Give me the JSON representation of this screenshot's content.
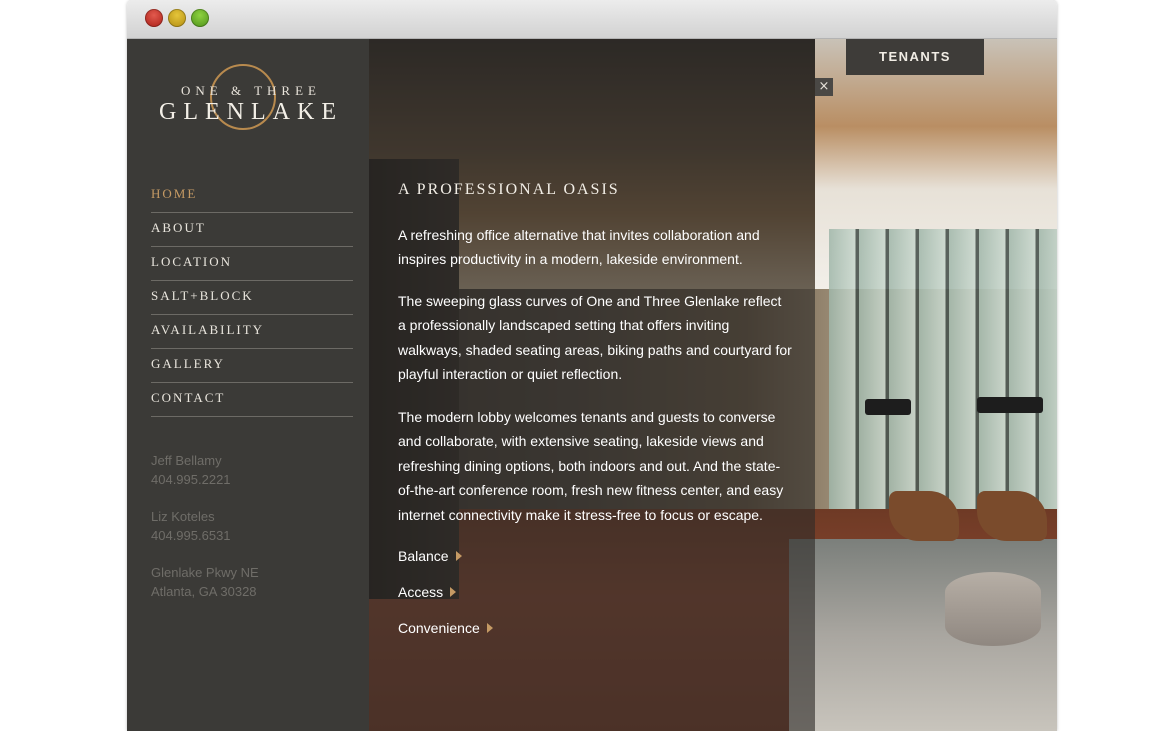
{
  "window": {
    "buttons": [
      "close",
      "minimize",
      "zoom"
    ]
  },
  "logo": {
    "top_line": "ONE & THREE",
    "main": "GLENLAKE",
    "accent_color": "#b88a4e"
  },
  "nav": {
    "items": [
      {
        "label": "HOME",
        "active": true
      },
      {
        "label": "ABOUT",
        "active": false
      },
      {
        "label": "LOCATION",
        "active": false
      },
      {
        "label": "SALT+BLOCK",
        "active": false
      },
      {
        "label": "AVAILABILITY",
        "active": false
      },
      {
        "label": "GALLERY",
        "active": false
      },
      {
        "label": "CONTACT",
        "active": false
      }
    ],
    "active_color": "#c59a64"
  },
  "contacts": {
    "people": [
      {
        "name": "Jeff Bellamy",
        "phone": "404.995.2221"
      },
      {
        "name": "Liz Koteles",
        "phone": "404.995.6531"
      }
    ],
    "address": {
      "line1": "Glenlake Pkwy NE",
      "line2": "Atlanta, GA 30328"
    }
  },
  "panel": {
    "title": "A PROFESSIONAL OASIS",
    "paragraphs": [
      "A refreshing office alternative that invites collaboration and inspires productivity in a modern, lakeside environment.",
      "The sweeping glass curves of One and Three Glenlake reflect a professionally landscaped setting that offers inviting walkways, shaded seating areas, biking paths and courtyard for playful interaction or quiet reflection.",
      "The modern lobby welcomes tenants and guests to converse and collaborate, with extensive seating, lakeside views and refreshing dining options, both indoors and out. And the state-of-the-art conference room, fresh new fitness center, and easy internet connectivity make it stress-free to focus or escape."
    ],
    "links": [
      "Balance",
      "Access",
      "Convenience"
    ],
    "close_glyph": "×"
  },
  "tenants_button": "TENANTS"
}
